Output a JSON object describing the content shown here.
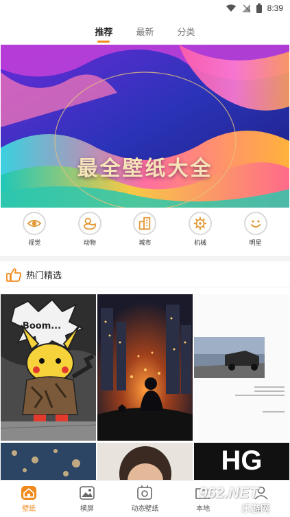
{
  "status_bar": {
    "time": "8:39"
  },
  "tabs": [
    {
      "label": "推荐",
      "active": true
    },
    {
      "label": "最新",
      "active": false
    },
    {
      "label": "分类",
      "active": false
    }
  ],
  "banner": {
    "title": "最全壁纸大全"
  },
  "categories": [
    {
      "label": "视觉",
      "icon": "eye-icon"
    },
    {
      "label": "动物",
      "icon": "duck-icon"
    },
    {
      "label": "城市",
      "icon": "building-icon"
    },
    {
      "label": "机械",
      "icon": "gear-icon"
    },
    {
      "label": "明星",
      "icon": "smile-icon"
    }
  ],
  "section": {
    "title": "热门精选",
    "icon": "thumbs-up-icon"
  },
  "wallpapers": {
    "tile1_text": "Boom...",
    "tile6_text": "HG"
  },
  "bottom_nav": [
    {
      "label": "壁纸",
      "icon": "home-icon",
      "active": true
    },
    {
      "label": "横屏",
      "icon": "image-icon",
      "active": false
    },
    {
      "label": "动态壁纸",
      "icon": "live-image-icon",
      "active": false
    },
    {
      "label": "本地",
      "icon": "folder-icon",
      "active": false
    },
    {
      "label": "我的",
      "icon": "user-icon",
      "active": false
    }
  ],
  "watermark": {
    "text": "962.NET",
    "sub": "乐游网"
  },
  "colors": {
    "accent": "#f08a1c",
    "divider": "#f3f3f3"
  }
}
